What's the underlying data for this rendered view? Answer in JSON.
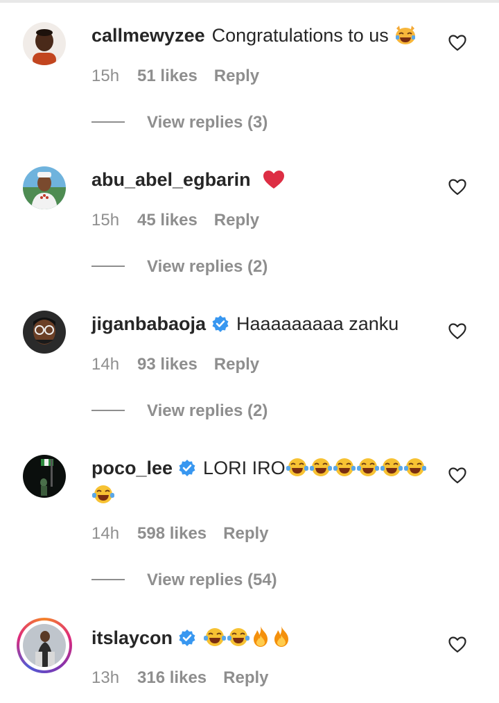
{
  "comments": [
    {
      "username": "callmewyzee",
      "verified": false,
      "text": "Congratulations to us",
      "emojis": [
        "cat-joy-icon"
      ],
      "time": "15h",
      "likes": "51 likes",
      "reply": "Reply",
      "view_replies": "View replies (3)"
    },
    {
      "username": "abu_abel_egbarin",
      "verified": false,
      "text": "",
      "emojis": [
        "red-heart-icon"
      ],
      "time": "15h",
      "likes": "45 likes",
      "reply": "Reply",
      "view_replies": "View replies (2)"
    },
    {
      "username": "jiganbabaoja",
      "verified": true,
      "text": "Haaaaaaaaa zanku",
      "emojis": [],
      "time": "14h",
      "likes": "93 likes",
      "reply": "Reply",
      "view_replies": "View replies (2)"
    },
    {
      "username": "poco_lee",
      "verified": true,
      "text": "LORI IRO",
      "emojis": [
        "joy-icon",
        "joy-icon",
        "joy-icon",
        "joy-icon",
        "joy-icon",
        "joy-icon",
        "joy-icon"
      ],
      "time": "14h",
      "likes": "598 likes",
      "reply": "Reply",
      "view_replies": "View replies (54)"
    },
    {
      "username": "itslaycon",
      "verified": true,
      "text": "",
      "emojis": [
        "joy-icon",
        "joy-icon",
        "fire-icon",
        "fire-icon"
      ],
      "time": "13h",
      "likes": "316 likes",
      "reply": "Reply"
    }
  ],
  "colors": {
    "text": "#262626",
    "muted": "#8e8e8e",
    "verified": "#3897f0",
    "heart_emoji": "#e0245e"
  }
}
